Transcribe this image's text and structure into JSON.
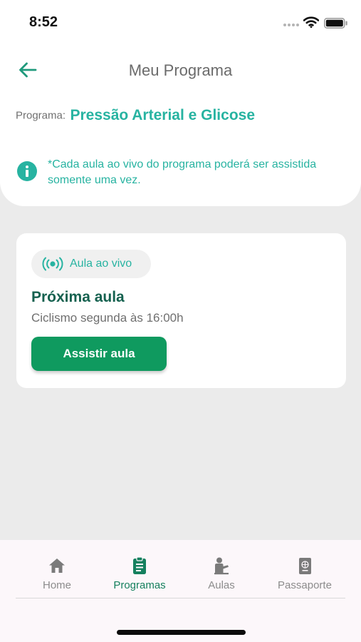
{
  "status_bar": {
    "time": "8:52",
    "icons": [
      "signal-dots-icon",
      "wifi-icon",
      "battery-icon"
    ]
  },
  "header": {
    "title": "Meu Programa",
    "back_icon": "arrow-left-icon"
  },
  "program": {
    "label": "Programa:",
    "name": "Pressão Arterial e Glicose"
  },
  "info_note": {
    "icon": "info-icon",
    "text": "*Cada aula ao vivo do programa poderá ser assistida somente uma vez."
  },
  "class_card": {
    "badge_icon": "live-broadcast-icon",
    "badge_label": "Aula ao vivo",
    "title": "Próxima aula",
    "subtitle": "Ciclismo segunda às 16:00h",
    "button_label": "Assistir aula"
  },
  "tab_bar": {
    "active_index": 1,
    "items": [
      {
        "label": "Home",
        "icon": "home-icon"
      },
      {
        "label": "Programas",
        "icon": "clipboard-icon"
      },
      {
        "label": "Aulas",
        "icon": "person-class-icon"
      },
      {
        "label": "Passaporte",
        "icon": "passport-icon"
      }
    ]
  },
  "colors": {
    "accent_teal": "#27b3a1",
    "primary_green": "#0f9a5f",
    "dark_green": "#15614f",
    "active_tab": "#15805e",
    "inactive_tab": "#8c8c8c",
    "background": "#ebebeb"
  }
}
